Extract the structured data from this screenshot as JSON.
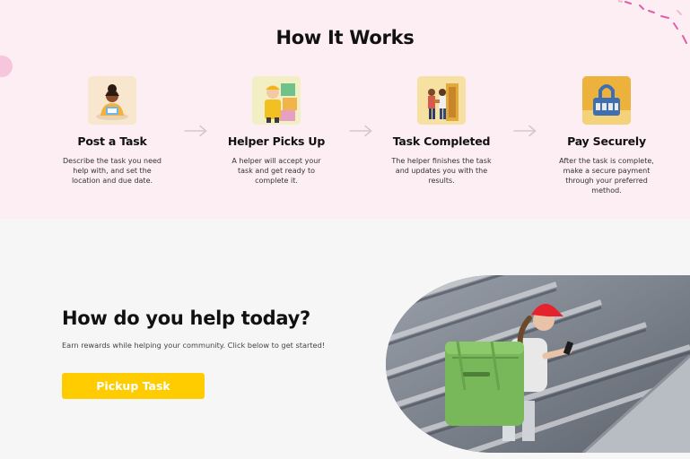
{
  "how_it_works": {
    "title": "How It Works",
    "steps": [
      {
        "title": "Post a Task",
        "description": "Describe the task you need help with, and set the location and due date.",
        "icon": "person-writing-icon"
      },
      {
        "title": "Helper Picks Up",
        "description": "A helper will accept your task and get ready to complete it.",
        "icon": "worker-with-boxes-icon"
      },
      {
        "title": "Task Completed",
        "description": "The helper finishes the task and updates you with the results.",
        "icon": "handover-icon"
      },
      {
        "title": "Pay Securely",
        "description": "After the task is complete, make a secure payment through your preferred method.",
        "icon": "padlock-icon"
      }
    ],
    "arrow_icon": "arrow-right-icon"
  },
  "help": {
    "title": "How do you help today?",
    "subtitle": "Earn rewards while helping your community. Click below to get started!",
    "button_label": "Pickup Task",
    "button_color": "#ffcc00"
  },
  "colors": {
    "top_background": "#fdeef4",
    "page_background": "#f6f6f6",
    "accent": "#ffcc00",
    "decoration_pink": "#e25fa8"
  }
}
